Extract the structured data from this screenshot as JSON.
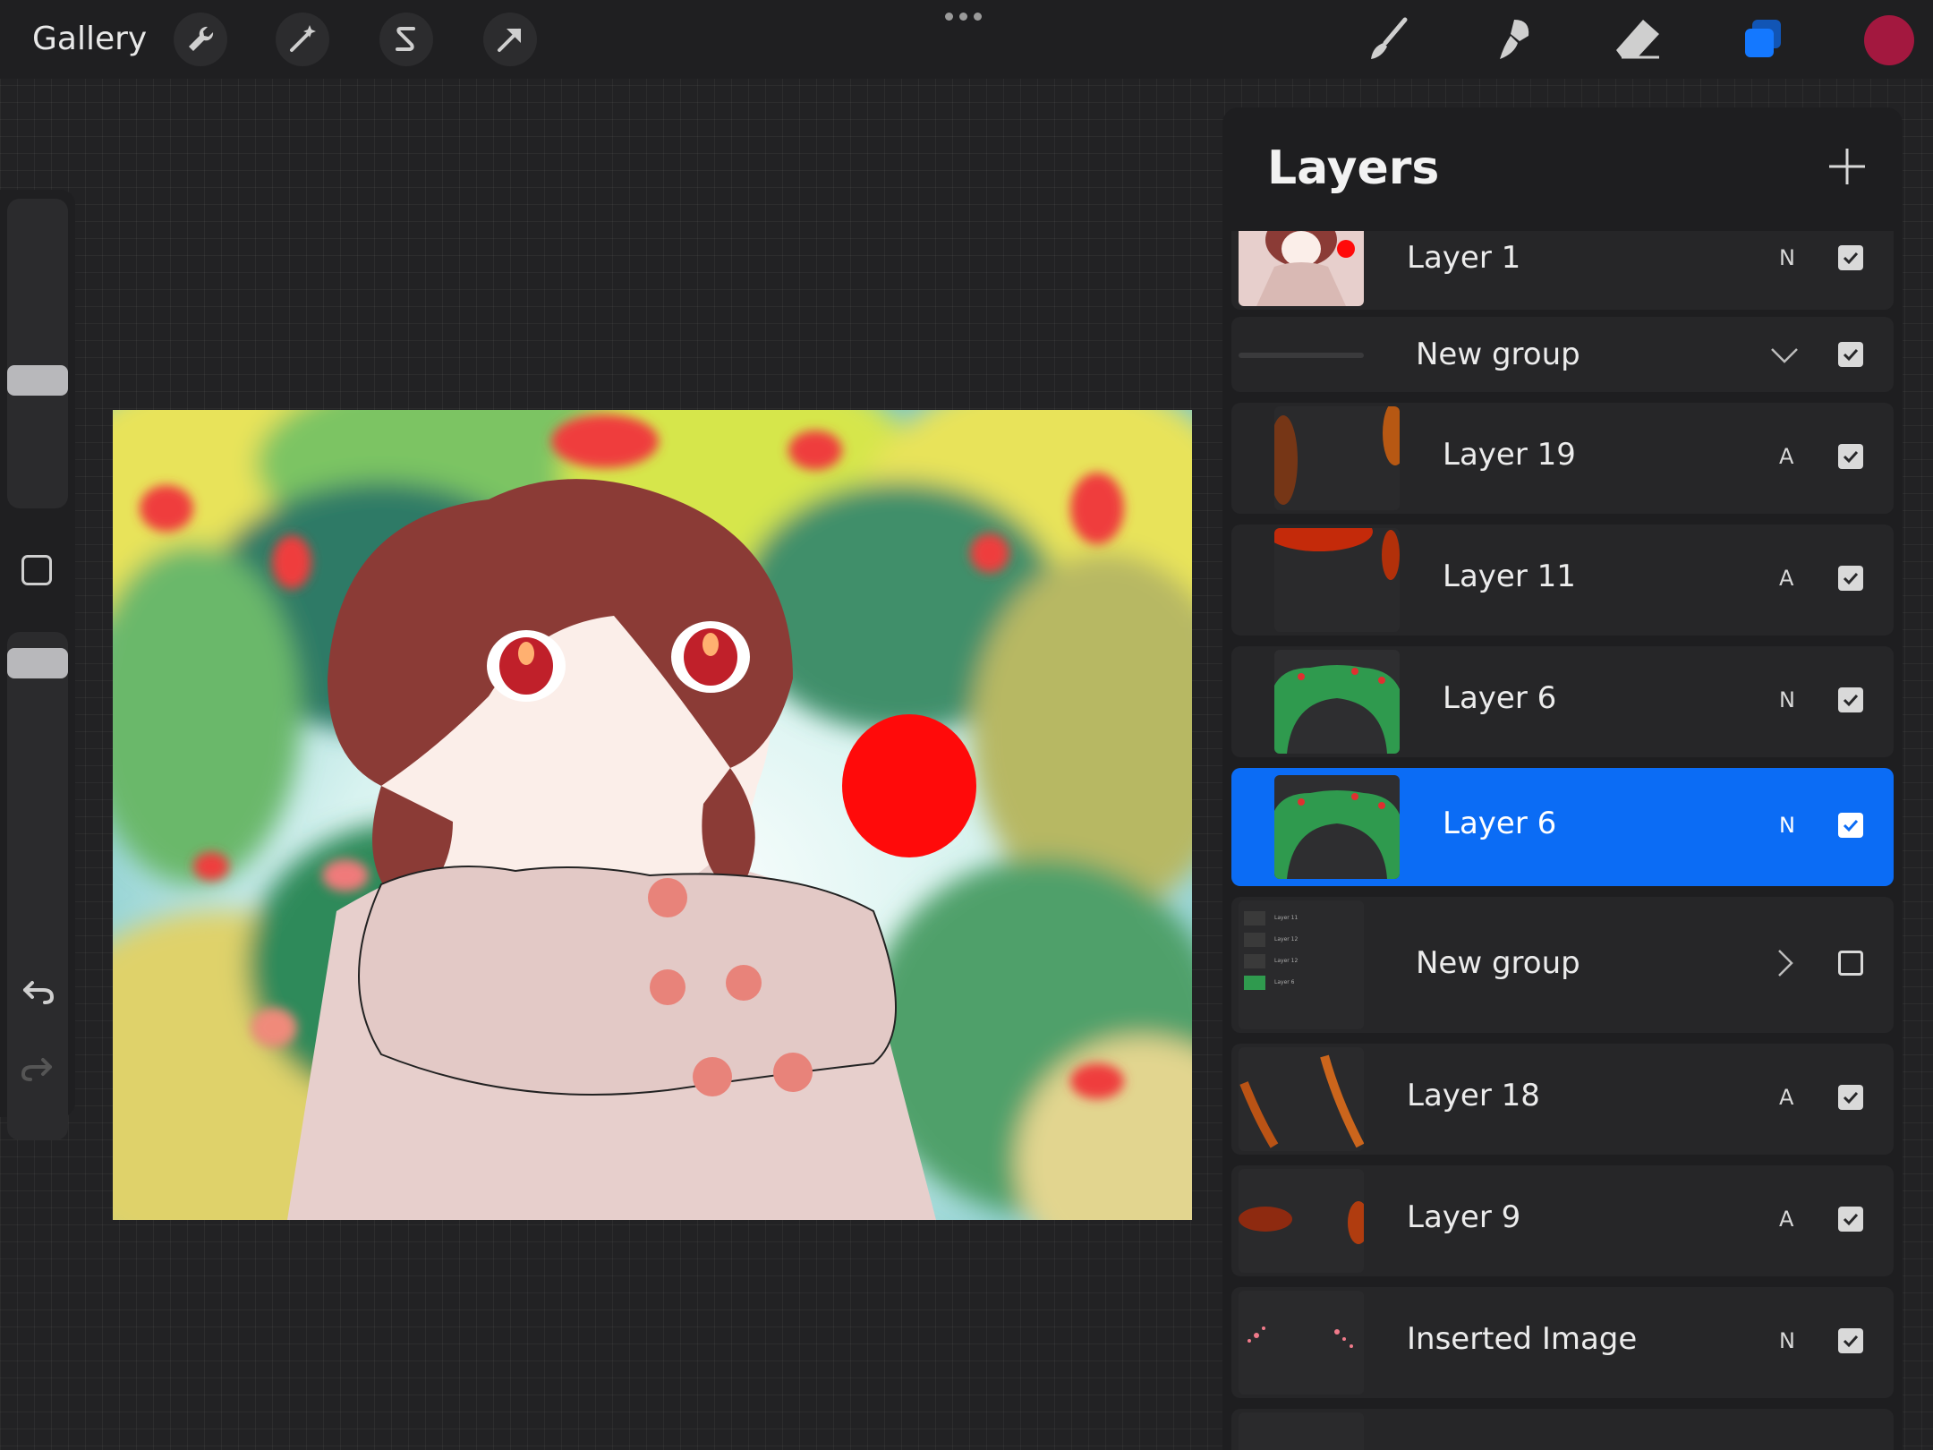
{
  "topbar": {
    "gallery_label": "Gallery",
    "left_tools": [
      "wrench-icon",
      "magic-wand-icon",
      "selection-icon",
      "transform-arrow-icon"
    ],
    "right_tools": [
      "brush-icon",
      "smudge-icon",
      "eraser-icon",
      "layers-icon"
    ],
    "active_color": "#a3183f",
    "accent": "#0b6cf5"
  },
  "panel": {
    "title": "Layers",
    "layers": [
      {
        "name": "Layer 1",
        "blend": "N",
        "visible": true
      },
      {
        "name": "New group",
        "blend": "",
        "visible": true,
        "group": true,
        "expanded": true
      },
      {
        "name": "Layer 19",
        "blend": "A",
        "visible": true
      },
      {
        "name": "Layer 11",
        "blend": "A",
        "visible": true
      },
      {
        "name": "Layer 6",
        "blend": "N",
        "visible": true
      },
      {
        "name": "Layer 6",
        "blend": "N",
        "visible": true,
        "selected": true
      },
      {
        "name": "New group",
        "blend": "",
        "visible": false,
        "group": true,
        "expanded": false
      },
      {
        "name": "Layer 18",
        "blend": "A",
        "visible": true
      },
      {
        "name": "Layer 9",
        "blend": "A",
        "visible": true
      },
      {
        "name": "Inserted Image",
        "blend": "N",
        "visible": true
      }
    ],
    "group_thumb_labels": [
      "Layer 11",
      "Layer 12",
      "Layer 12",
      "Layer 6"
    ]
  }
}
